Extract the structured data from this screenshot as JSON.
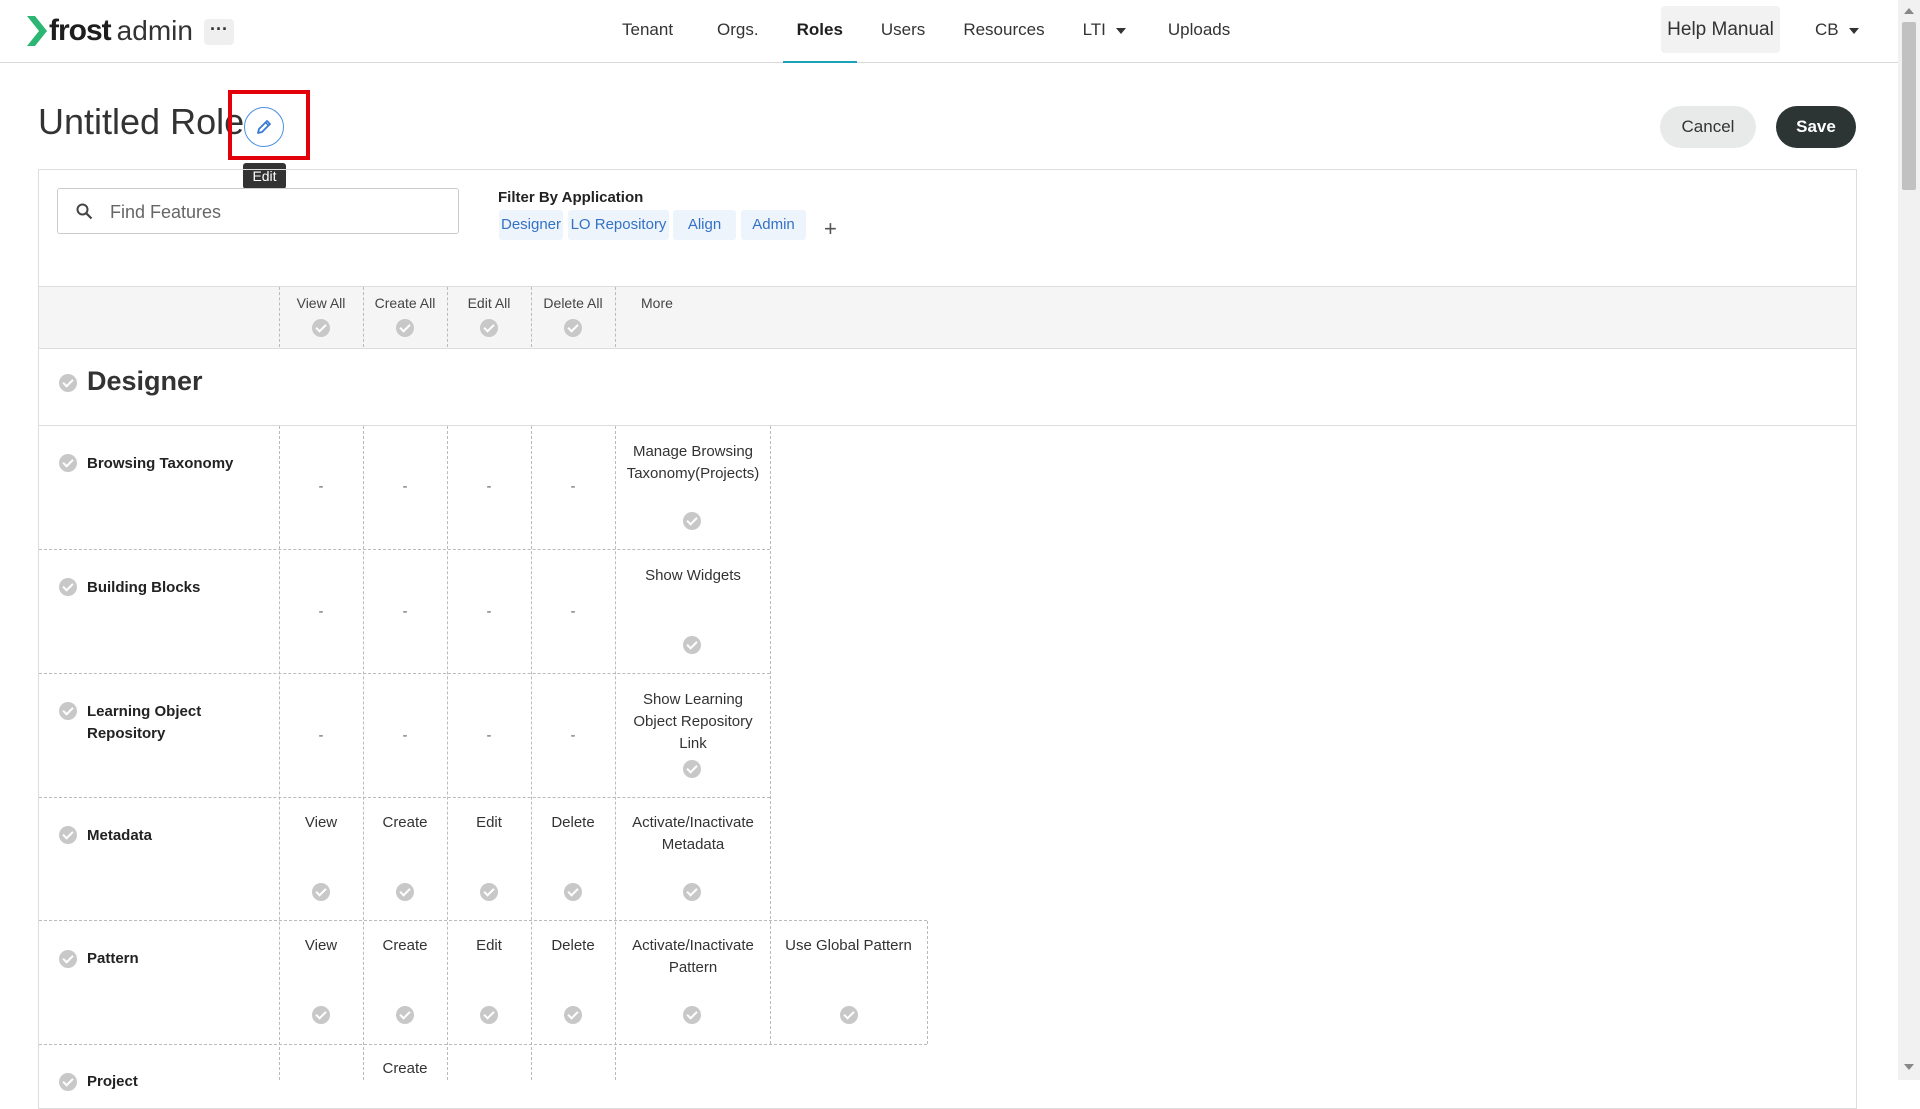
{
  "app": {
    "brand": "frost",
    "sub": "admin"
  },
  "nav": {
    "items": [
      "Tenant",
      "Orgs.",
      "Roles",
      "Users",
      "Resources",
      "LTI",
      "Uploads"
    ],
    "active": "Roles"
  },
  "header": {
    "help_label": "Help Manual",
    "user_initials": "CB"
  },
  "role": {
    "title": "Untitled Role",
    "edit_tooltip": "Edit"
  },
  "actions": {
    "cancel_label": "Cancel",
    "save_label": "Save"
  },
  "search": {
    "placeholder": "Find Features",
    "value": ""
  },
  "filter": {
    "label": "Filter By Application",
    "chips": [
      "Designer",
      "LO Repository",
      "Align",
      "Admin"
    ],
    "add_label": "+"
  },
  "columns": [
    "View All",
    "Create All",
    "Edit All",
    "Delete All",
    "More"
  ],
  "section": {
    "title": "Designer"
  },
  "rows": [
    {
      "label": "Browsing Taxonomy",
      "cells": [
        "-",
        "-",
        "-",
        "-"
      ],
      "more": [
        "Manage Browsing Taxonomy(Projects)"
      ]
    },
    {
      "label": "Building Blocks",
      "cells": [
        "-",
        "-",
        "-",
        "-"
      ],
      "more": [
        "Show Widgets"
      ]
    },
    {
      "label": "Learning Object Repository",
      "cells": [
        "-",
        "-",
        "-",
        "-"
      ],
      "more": [
        "Show Learning Object Repository Link"
      ]
    },
    {
      "label": "Metadata",
      "cells": [
        "View",
        "Create",
        "Edit",
        "Delete"
      ],
      "more": [
        "Activate/Inactivate Metadata"
      ]
    },
    {
      "label": "Pattern",
      "cells": [
        "View",
        "Create",
        "Edit",
        "Delete"
      ],
      "more": [
        "Activate/Inactivate Pattern",
        "Use Global Pattern"
      ]
    },
    {
      "label": "Project",
      "cells": [
        "",
        "Create",
        "",
        ""
      ],
      "more": []
    }
  ],
  "colors": {
    "accent": "#1aa3b6",
    "primary_button": "#2c3434",
    "highlight": "#e3000b",
    "chip_text": "#3372c4",
    "logo_green": "#2bb673"
  },
  "icons": [
    "frost-logo-icon",
    "ellipsis-icon",
    "caret-down-icon",
    "pencil-icon",
    "search-icon",
    "plus-icon",
    "check-circle-icon"
  ]
}
